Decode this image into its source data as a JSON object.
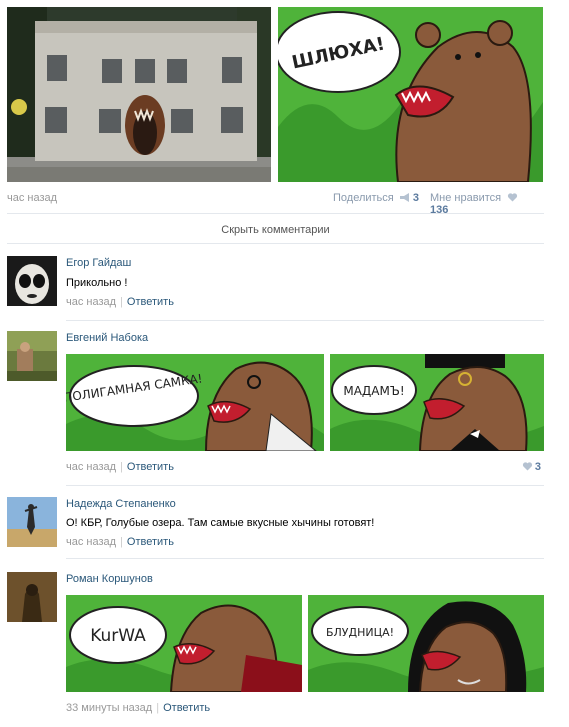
{
  "post": {
    "time": "час назад",
    "share_label": "Поделиться",
    "share_count": "3",
    "like_label": "Мне нравится",
    "like_count": "136",
    "bear_bubble": "ШЛЮХА!"
  },
  "hide_comments": "Скрыть комментарии",
  "comments": [
    {
      "author": "Егор Гайдаш",
      "text": "Прикольно !",
      "time": "час назад",
      "reply": "Ответить"
    },
    {
      "author": "Евгений Набока",
      "time": "час назад",
      "reply": "Ответить",
      "like_count": "3",
      "bubbles": [
        "ПОЛИГАМНАЯ САМКА!",
        "МАДАМЪ!"
      ]
    },
    {
      "author": "Надежда Степаненко",
      "text": "О! КБР, Голубые озера. Там самые вкусные хычины готовят!",
      "time": "час назад",
      "reply": "Ответить"
    },
    {
      "author": "Роман Коршунов",
      "time": "33 минуты назад",
      "reply": "Ответить",
      "bubbles": [
        "KurWA",
        "БЛУДНИЦА!"
      ]
    }
  ],
  "colors": {
    "link": "#2b587a",
    "meta": "#999999",
    "meme_green": "#3fae2a",
    "bear_brown": "#8a5a3b"
  }
}
